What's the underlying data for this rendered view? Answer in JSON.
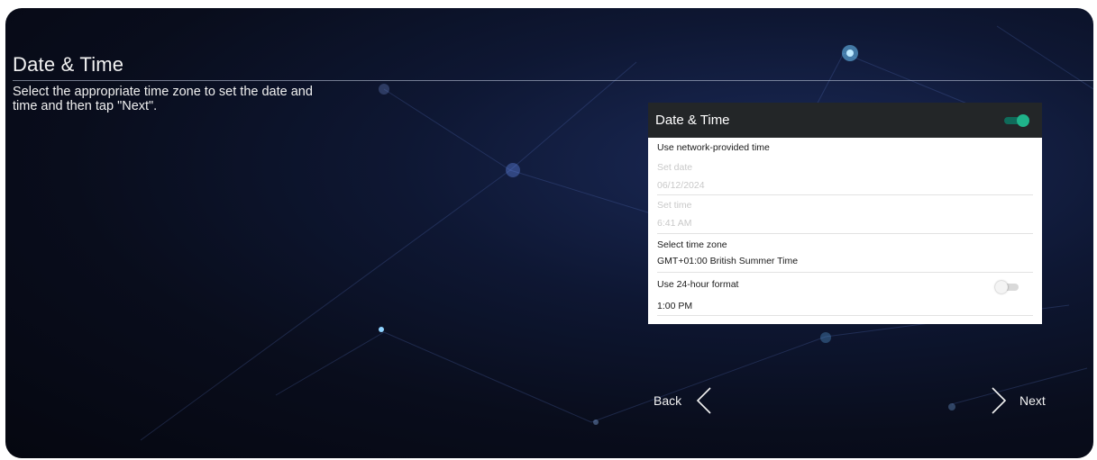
{
  "page": {
    "title": "Date & Time",
    "instructions": "Select the appropriate time zone to set the date and time and then tap \"Next\"."
  },
  "panel": {
    "title": "Date & Time",
    "header_toggle_on": true,
    "network_time_label": "Use network-provided time",
    "set_date_label": "Set date",
    "set_date_value": "06/12/2024",
    "set_time_label": "Set time",
    "set_time_value": "6:41 AM",
    "time_zone_label": "Select time zone",
    "time_zone_value": "GMT+01:00 British Summer Time",
    "format_24_label": "Use 24-hour format",
    "format_24_on": false,
    "format_24_sample": "1:00 PM"
  },
  "nav": {
    "back_label": "Back",
    "next_label": "Next",
    "back_icon": "chevron-left-icon",
    "next_icon": "chevron-right-icon"
  },
  "colors": {
    "accent": "#1fb38a",
    "panel_header": "#232628",
    "background": "#0b1024"
  }
}
